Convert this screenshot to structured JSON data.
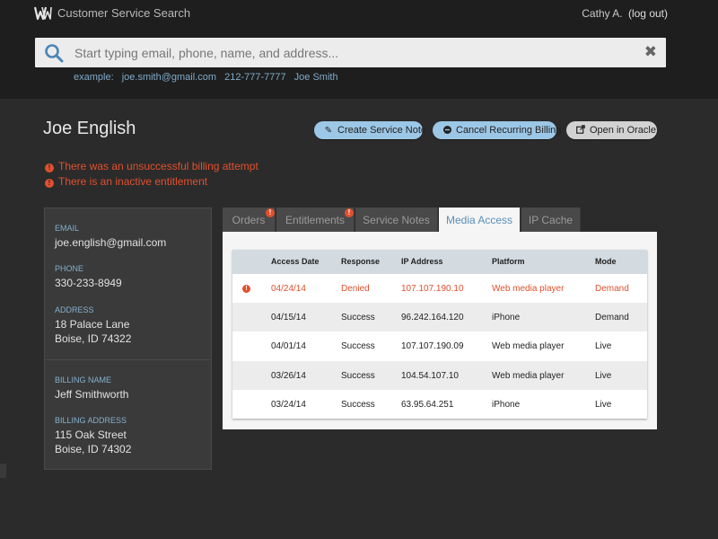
{
  "app": {
    "title": "Customer Service Search",
    "user": "Cathy A.",
    "logout": "(log out)"
  },
  "search": {
    "placeholder": "Start typing email, phone, name, and address...",
    "value": "",
    "clear": "✖",
    "examples_label": "example:",
    "examples": [
      "joe.smith@gmail.com",
      "212-777-7777",
      "Joe Smith"
    ]
  },
  "customer": {
    "name": "Joe English",
    "alerts": [
      "There was an unsuccessful billing attempt",
      "There is an inactive entitlement"
    ]
  },
  "actions": {
    "create_note": "Create Service Note",
    "cancel_billing": "Cancel Recurring Billing",
    "open_oracle": "Open in Oracle"
  },
  "contact": {
    "email_label": "Email",
    "email": "joe.english@gmail.com",
    "phone_label": "Phone",
    "phone": "330-233-8949",
    "address_label": "Address",
    "address_line1": "18 Palace Lane",
    "address_line2": "Boise, ID 74322"
  },
  "billing": {
    "name_label": "Billing Name",
    "name": "Jeff Smithworth",
    "address_label": "Billing Address",
    "address_line1": "115 Oak Street",
    "address_line2": "Boise, ID 74302"
  },
  "tabs": [
    {
      "label": "Orders",
      "alert": true
    },
    {
      "label": "Entitlements",
      "alert": true
    },
    {
      "label": "Service Notes",
      "alert": false
    },
    {
      "label": "Media Access",
      "alert": false,
      "active": true
    },
    {
      "label": "IP Cache",
      "alert": false
    }
  ],
  "media_table": {
    "headers": [
      "Access Date",
      "Response",
      "IP Address",
      "Platform",
      "Mode"
    ],
    "rows": [
      {
        "date": "04/24/14",
        "response": "Denied",
        "ip": "107.107.190.10",
        "platform": "Web media player",
        "mode": "Demand",
        "error": true
      },
      {
        "date": "04/15/14",
        "response": "Success",
        "ip": "96.242.164.120",
        "platform": "iPhone",
        "mode": "Demand",
        "error": false
      },
      {
        "date": "04/01/14",
        "response": "Success",
        "ip": "107.107.190.09",
        "platform": "Web media player",
        "mode": "Live",
        "error": false
      },
      {
        "date": "03/26/14",
        "response": "Success",
        "ip": "104.54.107.10",
        "platform": "Web media player",
        "mode": "Live",
        "error": false
      },
      {
        "date": "03/24/14",
        "response": "Success",
        "ip": "63.95.64.251",
        "platform": "iPhone",
        "mode": "Live",
        "error": false
      }
    ]
  },
  "colors": {
    "accent": "#9cc7e6",
    "error": "#e0502e",
    "link": "#7fa9c7"
  }
}
